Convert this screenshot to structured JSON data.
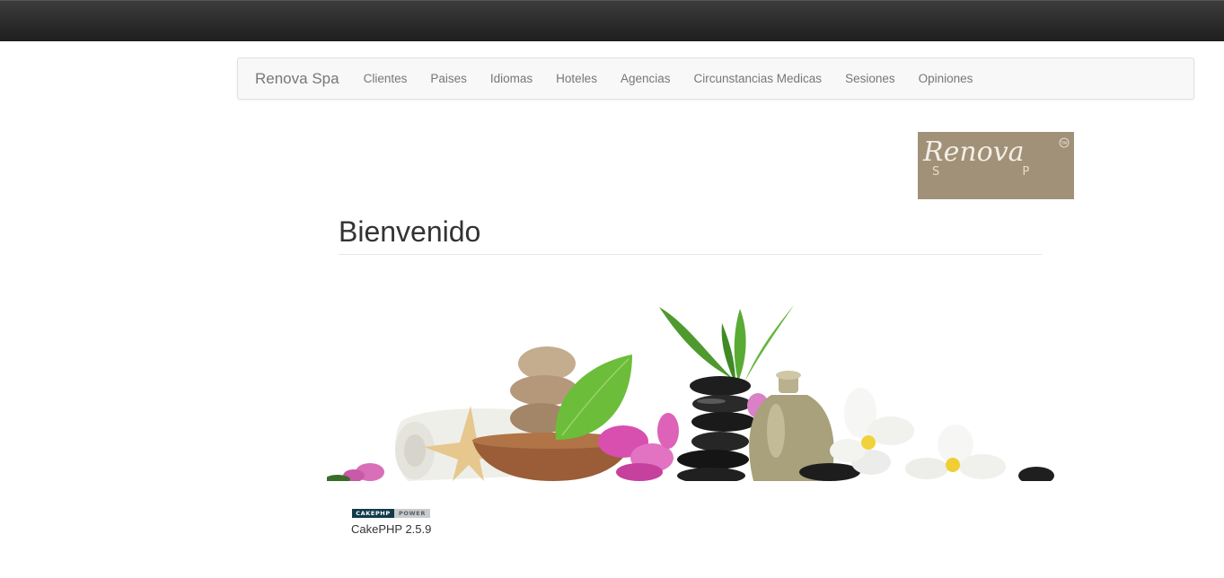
{
  "navbar": {
    "brand": "Renova Spa",
    "items": [
      {
        "label": "Clientes"
      },
      {
        "label": "Paises"
      },
      {
        "label": "Idiomas"
      },
      {
        "label": "Hoteles"
      },
      {
        "label": "Agencias"
      },
      {
        "label": "Circunstancias Medicas"
      },
      {
        "label": "Sesiones"
      },
      {
        "label": "Opiniones"
      }
    ]
  },
  "logo": {
    "text": "Renova",
    "subtext": "S P A",
    "mark": "TM",
    "background": "#a09178"
  },
  "main": {
    "title": "Bienvenido"
  },
  "footer": {
    "badge_left": "CAKEPHP",
    "badge_right": "POWER",
    "version": "CakePHP 2.5.9"
  },
  "colors": {
    "topbar": "#222222",
    "navbar_bg": "#f8f8f8",
    "nav_text": "#777777"
  }
}
